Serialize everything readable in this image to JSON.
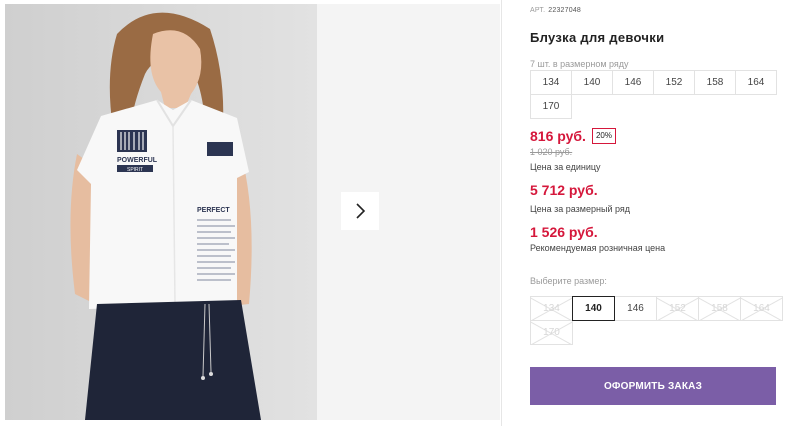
{
  "product": {
    "sku_label": "АРТ.",
    "sku": "22327048",
    "title": "Блузка для девочки",
    "pack_note": "7 шт. в размерном ряду",
    "pack_sizes": [
      "134",
      "140",
      "146",
      "152",
      "158",
      "164",
      "170"
    ]
  },
  "pricing": {
    "unit_price": "816 руб.",
    "discount": "20%",
    "old_price": "1 020 руб.",
    "unit_caption": "Цена за единицу",
    "set_price": "5 712 руб.",
    "set_caption": "Цена за размерный ряд",
    "retail_price": "1 526 руб.",
    "retail_caption": "Рекомендуемая розничная цена"
  },
  "size_select": {
    "label": "Выберите размер:",
    "options": [
      {
        "label": "134",
        "state": "unavailable"
      },
      {
        "label": "140",
        "state": "selected"
      },
      {
        "label": "146",
        "state": "available"
      },
      {
        "label": "152",
        "state": "unavailable"
      },
      {
        "label": "158",
        "state": "unavailable"
      },
      {
        "label": "164",
        "state": "unavailable"
      },
      {
        "label": "170",
        "state": "unavailable"
      }
    ]
  },
  "order_button": "ОФОРМИТЬ ЗАКАЗ",
  "icons": {
    "next_arrow": "chevron-right-icon"
  },
  "photo_print": {
    "powerful": "POWERFUL",
    "spirit": "SPIRIT",
    "perfect": "PERFECT"
  },
  "colors": {
    "price_red": "#d5173b",
    "button_purple": "#7b5ea7",
    "gallery_bg": "#f4f4f4"
  }
}
